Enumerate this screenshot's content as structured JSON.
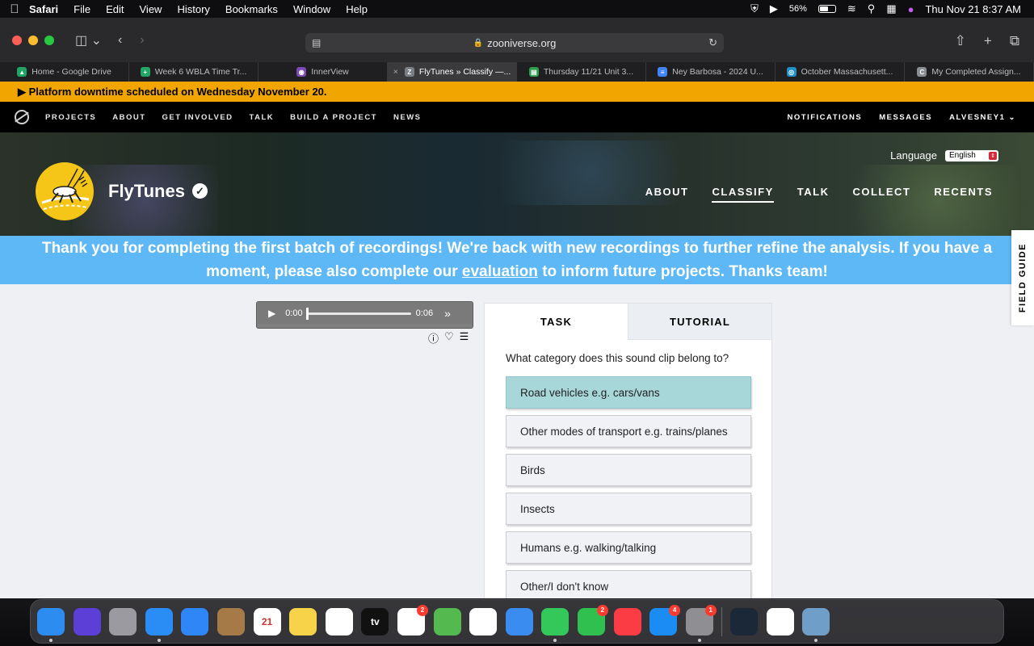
{
  "menubar": {
    "app": "Safari",
    "items": [
      "File",
      "Edit",
      "View",
      "History",
      "Bookmarks",
      "Window",
      "Help"
    ],
    "battery_percent": "56%",
    "battery_level": 0.56,
    "datetime": "Thu Nov 21  8:37 AM"
  },
  "browser": {
    "url": "zooniverse.org",
    "tabs": [
      {
        "label": "Home - Google Drive",
        "color": "#1fa463",
        "glyph": "▲"
      },
      {
        "label": "Week 6 WBLA Time Tr...",
        "color": "#23a566",
        "glyph": "+"
      },
      {
        "label": "InnerView",
        "color": "#7b4bb5",
        "glyph": "◉"
      },
      {
        "label": "FlyTunes » Classify —...",
        "color": "#7a7f86",
        "glyph": "Z"
      },
      {
        "label": "Thursday 11/21 Unit 3...",
        "color": "#2e9d4f",
        "glyph": "▤"
      },
      {
        "label": "Ney Barbosa - 2024 U...",
        "color": "#4285f4",
        "glyph": "≡"
      },
      {
        "label": "October Massachusett...",
        "color": "#1f8fc5",
        "glyph": "◎"
      },
      {
        "label": "My Completed Assign...",
        "color": "#8a8d92",
        "glyph": "C"
      }
    ],
    "active_tab": 3
  },
  "site": {
    "banner": "▶ Platform downtime scheduled on Wednesday November 20.",
    "nav": [
      "PROJECTS",
      "ABOUT",
      "GET INVOLVED",
      "TALK",
      "BUILD A PROJECT",
      "NEWS"
    ],
    "nav_right": [
      "NOTIFICATIONS",
      "MESSAGES",
      "ALVESNEY1"
    ]
  },
  "project": {
    "title": "FlyTunes",
    "language_label": "Language",
    "language_value": "English",
    "nav": [
      "ABOUT",
      "CLASSIFY",
      "TALK",
      "COLLECT",
      "RECENTS"
    ],
    "current_nav": "CLASSIFY",
    "announcement_line1": "Thank you for completing the first batch of recordings! We're back with new recordings to further refine the analysis. If you have a",
    "announcement_line2_before": "moment, please also complete our",
    "announcement_link": "evaluation",
    "announcement_line2_after": "to inform future projects. Thanks team!",
    "field_guide": "FIELD GUIDE"
  },
  "audio": {
    "current_time": "0:00",
    "duration": "0:06",
    "progress": 0
  },
  "task": {
    "tabs": [
      "TASK",
      "TUTORIAL"
    ],
    "question": "What category does this sound clip belong to?",
    "answers": [
      "Road vehicles e.g. cars/vans",
      "Other modes of transport e.g. trains/planes",
      "Birds",
      "Insects",
      "Humans e.g. walking/talking",
      "Other/I don't know"
    ],
    "selected_index": 0
  },
  "dock": {
    "apps": [
      {
        "name": "finder",
        "color": "#2d8cf0",
        "dot": true
      },
      {
        "name": "siri",
        "color": "#5b3fd6"
      },
      {
        "name": "launchpad",
        "color": "#9a9aa0"
      },
      {
        "name": "safari",
        "color": "#2a8df5",
        "dot": true
      },
      {
        "name": "mail",
        "color": "#2f86f6"
      },
      {
        "name": "contacts",
        "color": "#a57a47"
      },
      {
        "name": "calendar",
        "color": "#ffffff",
        "label": "21"
      },
      {
        "name": "notes",
        "color": "#f7d34a"
      },
      {
        "name": "freeform",
        "color": "#ffffff"
      },
      {
        "name": "tv",
        "color": "#111111",
        "label": "tv"
      },
      {
        "name": "reminders",
        "color": "#ffffff",
        "badge": "2"
      },
      {
        "name": "maps",
        "color": "#54b94f"
      },
      {
        "name": "photos",
        "color": "#ffffff"
      },
      {
        "name": "weather",
        "color": "#3a8cf0"
      },
      {
        "name": "messages",
        "color": "#34c759",
        "dot": true
      },
      {
        "name": "facetime",
        "color": "#30c04f",
        "badge": "2"
      },
      {
        "name": "music",
        "color": "#fc3c44"
      },
      {
        "name": "app-store",
        "color": "#1c8cf5",
        "badge": "4"
      },
      {
        "name": "system-settings",
        "color": "#8e8e93",
        "badge": "1",
        "dot": true
      },
      {
        "name": "steam",
        "color": "#1b2838"
      },
      {
        "name": "proton-vpn",
        "color": "#ffffff"
      },
      {
        "name": "preview",
        "color": "#6f9fc8",
        "dot": true
      }
    ]
  }
}
